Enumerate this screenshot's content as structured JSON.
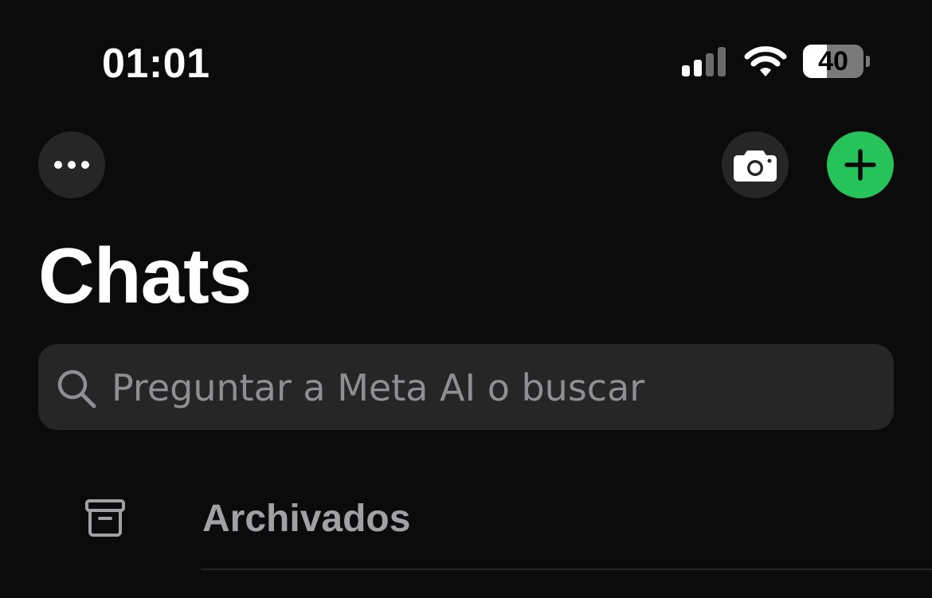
{
  "status_bar": {
    "time": "01:01",
    "battery_level": "40",
    "battery_fraction": 0.4,
    "signal_bars_active": 2,
    "signal_bars_total": 4,
    "icons": [
      "signal-icon",
      "wifi-icon",
      "battery-icon"
    ]
  },
  "header": {
    "more_icon": "ellipsis-icon",
    "camera_icon": "camera-icon",
    "new_chat_icon": "plus-icon",
    "accent_color": "#25c35a"
  },
  "title": "Chats",
  "search": {
    "placeholder": "Preguntar a Meta AI o buscar",
    "value": "",
    "icon": "search-icon"
  },
  "archived": {
    "label": "Archivados",
    "icon": "archive-icon"
  }
}
